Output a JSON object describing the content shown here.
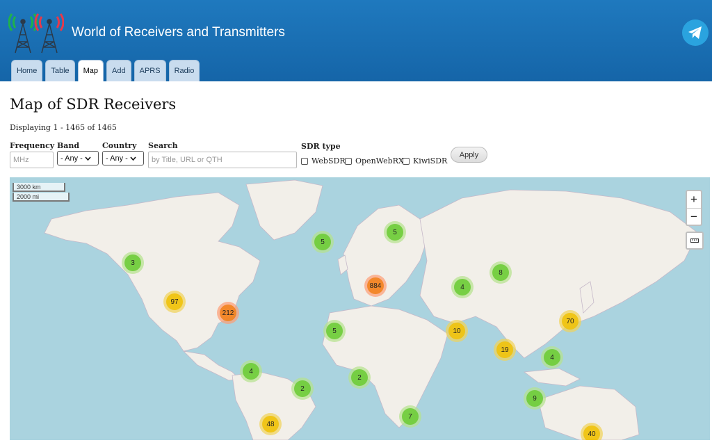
{
  "header": {
    "title": "World of Receivers and Transmitters",
    "tabs": [
      "Home",
      "Table",
      "Map",
      "Add",
      "APRS",
      "Radio"
    ],
    "active_tab": "Map"
  },
  "page": {
    "title": "Map of SDR Receivers",
    "displaying": "Displaying 1 - 1465 of 1465"
  },
  "filters": {
    "frequency_label": "Frequency",
    "frequency_placeholder": "MHz",
    "band_label": "Band",
    "band_value": "- Any -",
    "country_label": "Country",
    "country_value": "- Any -",
    "search_label": "Search",
    "search_placeholder": "by Title, URL or QTH",
    "sdr_type_label": "SDR type",
    "sdr_types": [
      "WebSDR",
      "OpenWebRX",
      "KiwiSDR"
    ],
    "apply_label": "Apply"
  },
  "map": {
    "scale_km": "3000 km",
    "scale_mi": "2000 mi",
    "zoom_in": "+",
    "zoom_out": "−",
    "clusters": [
      {
        "count": "3",
        "size": "small"
      },
      {
        "count": "97",
        "size": "med"
      },
      {
        "count": "212",
        "size": "large"
      },
      {
        "count": "5",
        "size": "small"
      },
      {
        "count": "5",
        "size": "small"
      },
      {
        "count": "884",
        "size": "large"
      },
      {
        "count": "5",
        "size": "small"
      },
      {
        "count": "4",
        "size": "small"
      },
      {
        "count": "8",
        "size": "small"
      },
      {
        "count": "10",
        "size": "med"
      },
      {
        "count": "70",
        "size": "med"
      },
      {
        "count": "19",
        "size": "med"
      },
      {
        "count": "4",
        "size": "small"
      },
      {
        "count": "4",
        "size": "small"
      },
      {
        "count": "2",
        "size": "small"
      },
      {
        "count": "2",
        "size": "small"
      },
      {
        "count": "9",
        "size": "small"
      },
      {
        "count": "7",
        "size": "small"
      },
      {
        "count": "48",
        "size": "med"
      },
      {
        "count": "40",
        "size": "med"
      }
    ]
  },
  "colors": {
    "header_blue": "#1f79be",
    "tab_bg": "#c9dcee",
    "ocean": "#aad3df",
    "land": "#f2efe9",
    "cluster_small": "#6ecc39",
    "cluster_med": "#f0c20c",
    "cluster_large": "#f18017",
    "telegram": "#2aa3df"
  }
}
